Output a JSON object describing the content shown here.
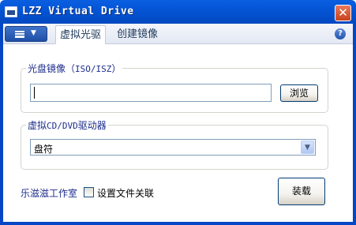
{
  "window": {
    "title": "LZZ Virtual Drive",
    "close_glyph": "✕"
  },
  "toolbar": {
    "menu_icon": "menu-icon",
    "menu_arrow": "▼",
    "tabs": [
      {
        "label": "虚拟光驱",
        "active": true
      },
      {
        "label": "创建镜像",
        "active": false
      }
    ],
    "help_glyph": "?"
  },
  "image_group": {
    "title_prefix": "光盘镜像（",
    "title_ascii": "ISO/ISZ",
    "title_suffix": "）",
    "path_value": "",
    "browse_label": "浏览"
  },
  "drive_group": {
    "title_prefix": "虚拟",
    "title_ascii": "CD/DVD",
    "title_suffix": "驱动器",
    "selected_drive": "盘符",
    "dropdown_glyph": "▼"
  },
  "footer": {
    "studio_label": "乐滋滋工作室",
    "file_assoc_label": "设置文件关联",
    "file_assoc_checked": false,
    "load_label": "装载"
  },
  "colors": {
    "titlebar": "#0455d6",
    "group_title": "#1d2d8c",
    "close_button": "#c8421e"
  }
}
